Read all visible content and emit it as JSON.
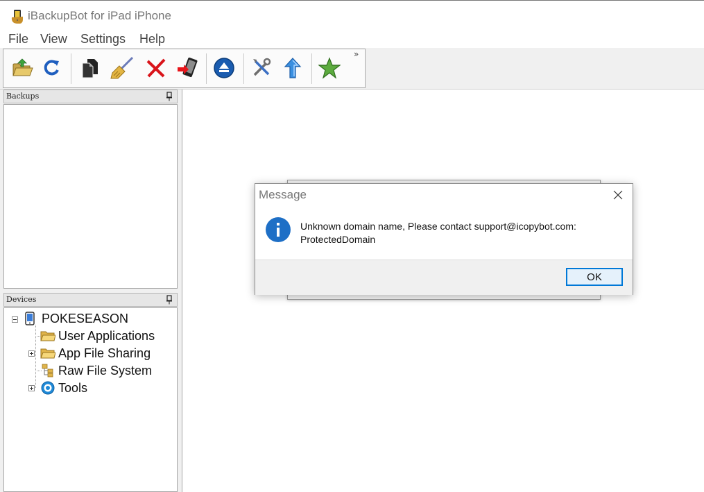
{
  "window": {
    "title": "iBackupBot for iPad iPhone",
    "icon": "ibackupbot-app-icon"
  },
  "menu": {
    "items": [
      {
        "label": "File"
      },
      {
        "label": "View"
      },
      {
        "label": "Settings"
      },
      {
        "label": "Help"
      }
    ]
  },
  "toolbar": {
    "buttons": [
      {
        "icon": "open-folder-icon"
      },
      {
        "icon": "refresh-icon"
      },
      {
        "icon": "copy-documents-icon"
      },
      {
        "icon": "broom-clean-icon"
      },
      {
        "icon": "delete-x-icon"
      },
      {
        "icon": "device-transfer-icon"
      },
      {
        "icon": "eject-icon"
      },
      {
        "icon": "tools-icon"
      },
      {
        "icon": "upload-arrow-icon"
      },
      {
        "icon": "star-icon"
      }
    ],
    "overflow_label": "»"
  },
  "backups_pane": {
    "title": "Backups"
  },
  "devices_pane": {
    "title": "Devices",
    "tree": {
      "device": "POKESEASON",
      "children": [
        {
          "label": "User Applications",
          "icon": "folder-icon",
          "expandable": false
        },
        {
          "label": "App File Sharing",
          "icon": "folder-icon",
          "expandable": true
        },
        {
          "label": "Raw File System",
          "icon": "file-system-icon",
          "expandable": false
        },
        {
          "label": "Tools",
          "icon": "gear-icon",
          "expandable": true
        }
      ]
    }
  },
  "dialog": {
    "title": "Message",
    "message_line1": "Unknown domain name, Please contact support@icopybot.com:",
    "message_line2": "ProtectedDomain",
    "ok_label": "OK"
  },
  "colors": {
    "accent": "#0078d7",
    "info_icon": "#1e6fc6"
  }
}
